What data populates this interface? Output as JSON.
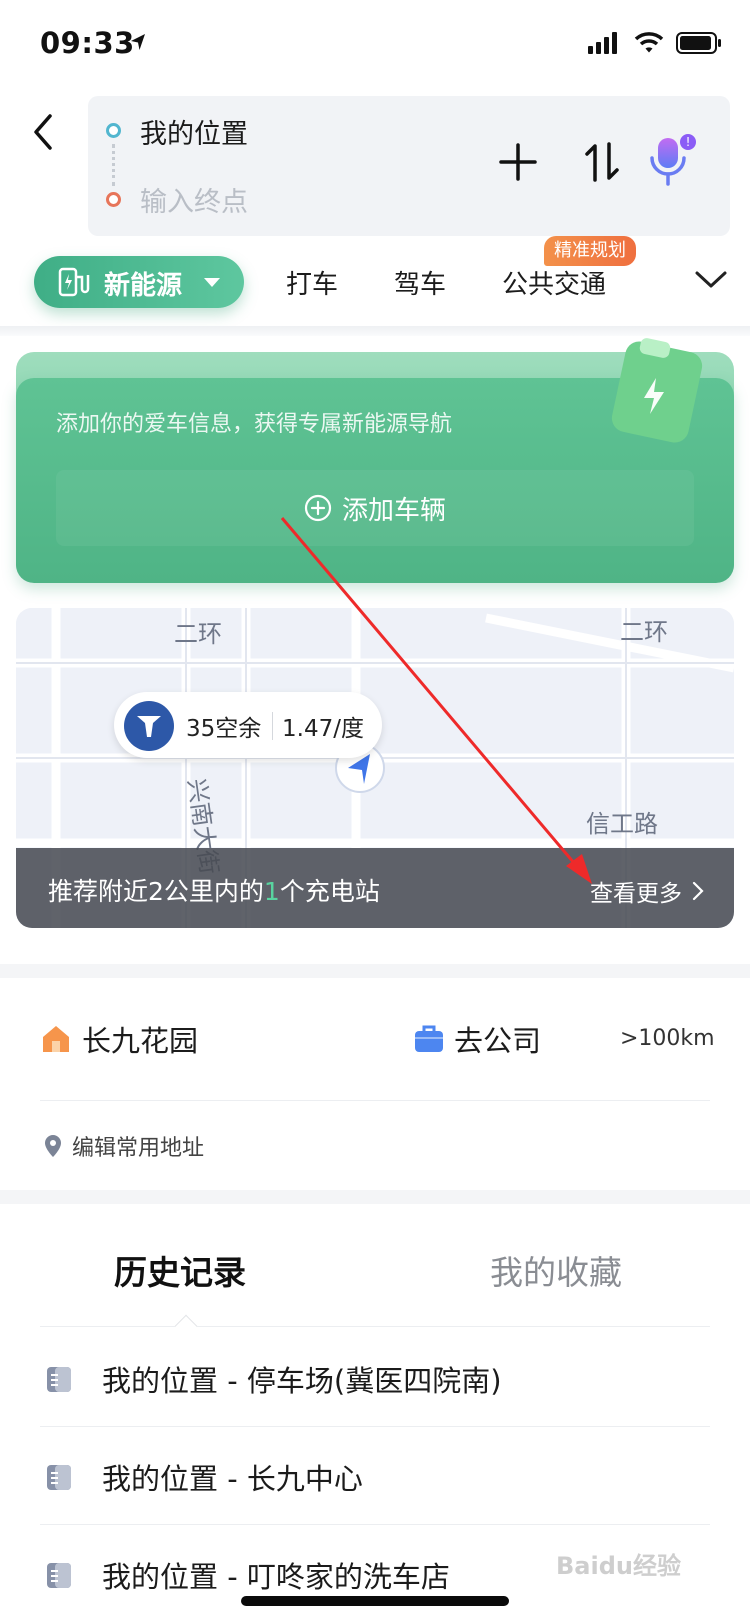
{
  "status_bar": {
    "time": "09:33"
  },
  "route": {
    "origin": "我的位置",
    "destination_placeholder": "输入终点"
  },
  "modes": {
    "active": "新能源",
    "tabs": [
      "打车",
      "驾车",
      "公共交通"
    ],
    "badge": "精准规划"
  },
  "vehicle_card": {
    "promo": "添加你的爱车信息，获得专属新能源导航",
    "add_button": "添加车辆"
  },
  "map": {
    "station_free": "35空余",
    "station_price": "1.47/度",
    "labels": [
      "二环",
      "二环",
      "兴南大街",
      "信工路"
    ],
    "recommend_prefix": "推荐附近2公里内的",
    "recommend_count": "1",
    "recommend_suffix": "个充电站",
    "see_more": "查看更多"
  },
  "places": {
    "home": "长九花园",
    "work": "去公司",
    "distance": ">100km",
    "edit": "编辑常用地址"
  },
  "history": {
    "tab_history": "历史记录",
    "tab_favorites": "我的收藏",
    "items": [
      "我的位置 - 停车场(冀医四院南)",
      "我的位置 - 长九中心",
      "我的位置 - 叮咚家的洗车店"
    ]
  },
  "watermark": "Baidu经验",
  "colors": {
    "accent_green": "#4fb486",
    "badge_orange": "#ef6f3f",
    "voice_purple": "#8b5cf6"
  }
}
